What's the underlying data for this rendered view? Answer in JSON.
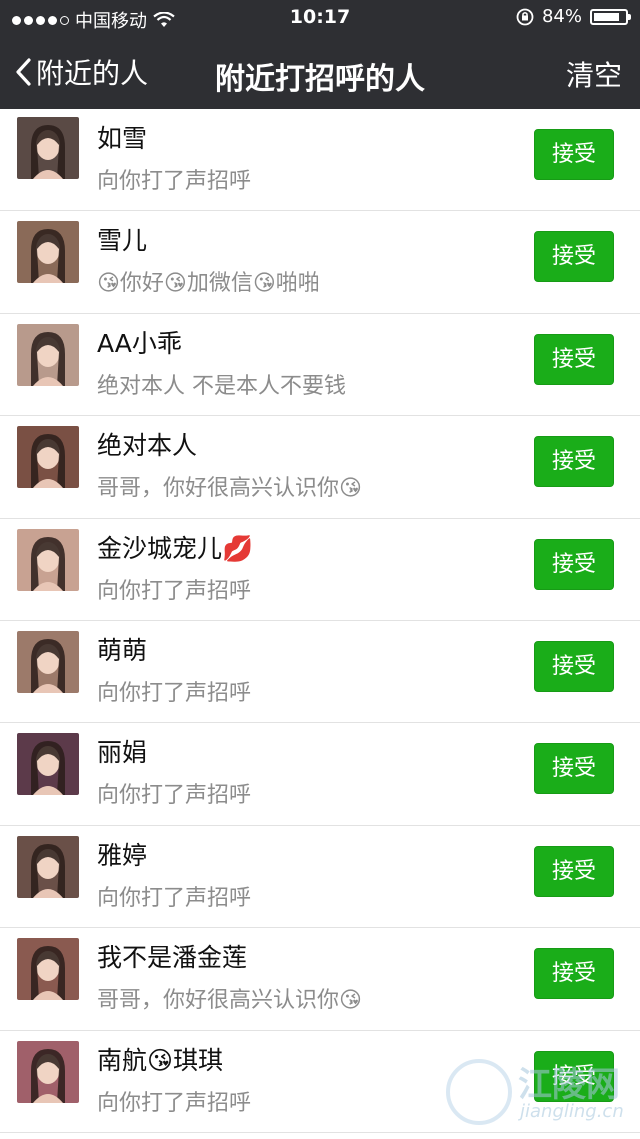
{
  "status_bar": {
    "carrier": "中国移动",
    "time": "10:17",
    "battery": "84%",
    "battery_level": 0.84
  },
  "nav": {
    "back_label": "附近的人",
    "title": "附近打招呼的人",
    "action_label": "清空"
  },
  "accept_label": "接受",
  "requests": [
    {
      "name": "如雪",
      "message": "向你打了声招呼",
      "avatar_color": "#5a4a45"
    },
    {
      "name": "雪儿",
      "message": "😘你好😘加微信😘啪啪",
      "avatar_color": "#8a6a58"
    },
    {
      "name": "AA小乖",
      "message": "绝对本人  不是本人不要钱",
      "avatar_color": "#b89a8c"
    },
    {
      "name": "绝对本人",
      "message": "哥哥，你好很高兴认识你😘",
      "avatar_color": "#7a5044"
    },
    {
      "name": "金沙城宠儿💋",
      "message": "向你打了声招呼",
      "avatar_color": "#c8a292"
    },
    {
      "name": "萌萌",
      "message": "向你打了声招呼",
      "avatar_color": "#9c7a6a"
    },
    {
      "name": "丽娟",
      "message": "向你打了声招呼",
      "avatar_color": "#5c3a4a"
    },
    {
      "name": "雅婷",
      "message": "向你打了声招呼",
      "avatar_color": "#6a5048"
    },
    {
      "name": "我不是潘金莲",
      "message": "哥哥，你好很高兴认识你😘",
      "avatar_color": "#8a5a50"
    },
    {
      "name": "南航😘琪琪",
      "message": "向你打了声招呼",
      "avatar_color": "#a0606a"
    }
  ],
  "watermark": {
    "text": "江陵网",
    "sub": "jiangling.cn"
  }
}
